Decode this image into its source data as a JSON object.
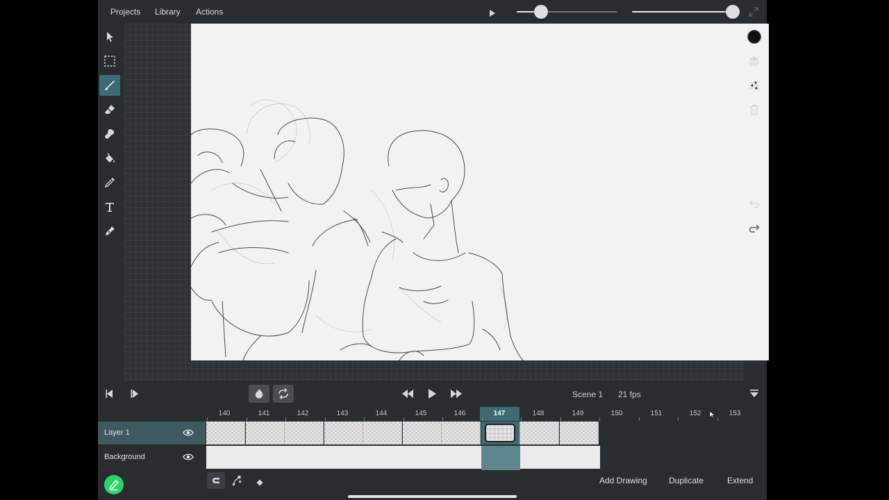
{
  "menu": {
    "projects": "Projects",
    "library": "Library",
    "actions": "Actions"
  },
  "sliders": {
    "opacity_value": 0.24,
    "size_value": 1.0
  },
  "tools": [
    "select-tool",
    "marquee-tool",
    "brush-tool",
    "eraser-tool",
    "smudge-tool",
    "fill-tool",
    "eyedropper-tool",
    "text-tool",
    "pen-tool"
  ],
  "active_tool": "brush-tool",
  "right_tools": [
    "color-swatch",
    "layers-icon",
    "adjustments-icon",
    "trash-icon",
    "undo-icon",
    "redo-icon"
  ],
  "colors": {
    "accent": "#3d6b73",
    "add_button": "#2bd46b",
    "color_swatch": "#111111"
  },
  "transport": {
    "scene": "Scene 1",
    "fps": "21 fps"
  },
  "timeline": {
    "frames": [
      "140",
      "141",
      "142",
      "143",
      "144",
      "145",
      "146",
      "147",
      "148",
      "149",
      "150",
      "151",
      "152",
      "153"
    ],
    "current_frame": "147",
    "drawn_frames": [
      "140",
      "141",
      "142",
      "143",
      "144",
      "145",
      "146",
      "147",
      "148",
      "149"
    ]
  },
  "layers": [
    {
      "name": "Layer 1",
      "visible": true,
      "selected": true
    },
    {
      "name": "Background",
      "visible": true,
      "selected": false
    }
  ],
  "bottom": {
    "add_drawing": "Add Drawing",
    "duplicate": "Duplicate",
    "extend": "Extend"
  }
}
